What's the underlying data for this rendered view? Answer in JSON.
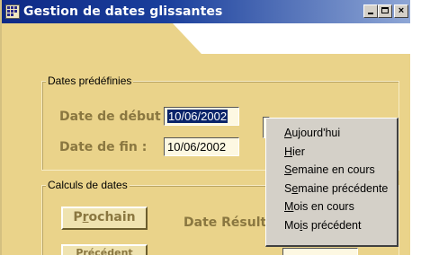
{
  "window": {
    "title": "Gestion de dates glissantes",
    "controls": {
      "minimize": "_",
      "maximize": "□",
      "close": "×"
    }
  },
  "predefined": {
    "legend": "Dates prédéfinies",
    "start_label": "Date de début :",
    "start_value": "10/06/2002",
    "end_label": "Date de fin :",
    "end_value": "10/06/2002"
  },
  "calc": {
    "legend": "Calculs de dates",
    "next_prefix": "P",
    "next_mnemonic": "r",
    "next_suffix": "ochain",
    "prev_label": "Précédent",
    "result_label": "Date Résultat"
  },
  "context_menu": {
    "items": [
      {
        "mn": "A",
        "rest": "ujourd'hui"
      },
      {
        "mn": "H",
        "rest": "ier"
      },
      {
        "mn": "S",
        "rest": "emaine en cours"
      },
      {
        "pre": "S",
        "mn": "e",
        "rest": "maine précédente"
      },
      {
        "mn": "M",
        "rest": "ois en cours"
      },
      {
        "pre": "Mo",
        "mn": "i",
        "rest": "s précédent"
      }
    ]
  },
  "colors": {
    "form_bg": "#ead38a",
    "title_bar": "#0f2a86",
    "label_text": "#8a7740",
    "menu_bg": "#d4d0c8"
  }
}
